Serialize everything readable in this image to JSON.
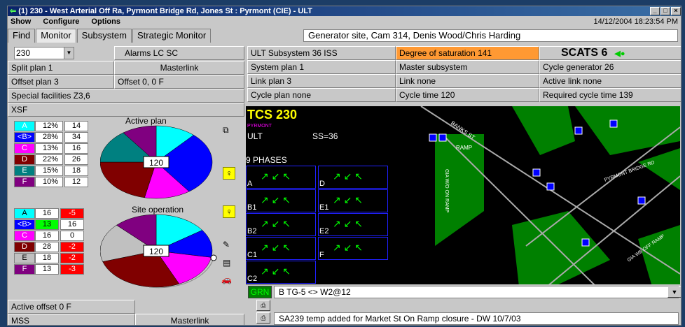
{
  "window": {
    "title": "(1)  230 - West Arterial Off Ra, Pyrmont Bridge Rd, Jones St : Pyrmont (CIE) - ULT"
  },
  "menu": [
    "Show",
    "Configure",
    "Options"
  ],
  "datetime": "14/12/2004  18:23:54 PM",
  "tabs": [
    "Find",
    "Monitor",
    "Subsystem",
    "Strategic Monitor"
  ],
  "site_description": "Generator site, Cam 314, Denis Wood/Chris Harding",
  "left": {
    "site_number": "230",
    "alarms": "Alarms LC SC",
    "split_plan": "Split plan 1",
    "masterlink": "Masterlink",
    "offset_plan": "Offset plan 3",
    "offset": "Offset 0, 0 F",
    "special": "Special facilities  Z3,6",
    "xsf": "XSF",
    "active_offset": "Active offset 0 F",
    "mss": "MSS",
    "masterlink_bottom": "Masterlink"
  },
  "active_plan": {
    "title": "Active plan",
    "cycle": "120",
    "rows": [
      {
        "phase": "A",
        "pct": "12%",
        "sec": "14",
        "color": "#00ffff"
      },
      {
        "phase": "<B>",
        "pct": "28%",
        "sec": "34",
        "color": "#0000ff"
      },
      {
        "phase": "C",
        "pct": "13%",
        "sec": "16",
        "color": "#ff00ff"
      },
      {
        "phase": "D",
        "pct": "22%",
        "sec": "26",
        "color": "#800000"
      },
      {
        "phase": "E",
        "pct": "15%",
        "sec": "18",
        "color": "#008080"
      },
      {
        "phase": "F",
        "pct": "10%",
        "sec": "12",
        "color": "#800080"
      }
    ]
  },
  "site_operation": {
    "title": "Site operation",
    "cycle": "120",
    "rows": [
      {
        "phase": "A",
        "actual": "16",
        "diff": "-5",
        "diffcolor": "#ff0000",
        "color": "#00ffff"
      },
      {
        "phase": "<B>",
        "actual": "13",
        "diff": "16",
        "diffcolor": "#ffffff",
        "color": "#0000ff",
        "actualcolor": "#00ff00"
      },
      {
        "phase": "C",
        "actual": "16",
        "diff": "0",
        "diffcolor": "#ffffff",
        "color": "#ff00ff"
      },
      {
        "phase": "D",
        "actual": "28",
        "diff": "-2",
        "diffcolor": "#ff0000",
        "color": "#800000"
      },
      {
        "phase": "E",
        "actual": "18",
        "diff": "-2",
        "diffcolor": "#ff0000",
        "color": "#c0c0c0"
      },
      {
        "phase": "F",
        "actual": "13",
        "diff": "-3",
        "diffcolor": "#ff0000",
        "color": "#800080"
      }
    ]
  },
  "info_grid": {
    "ult": "ULT Subsystem 36 ISS",
    "dos": "Degree of saturation 141",
    "scats": "SCATS 6",
    "system_plan": "System plan 1",
    "master_subsystem": "Master subsystem",
    "cycle_generator": "Cycle generator  26",
    "link_plan": "Link plan 3",
    "link_none": "Link none",
    "active_link": "Active link none",
    "cycle_plan": "Cycle plan none",
    "cycle_time": "Cycle time 120",
    "required_cycle": "Required cycle time 139"
  },
  "tcs": {
    "title": "TCS 230",
    "area": "PYRMONT",
    "ult": "ULT",
    "ss": "SS=36",
    "phases_label": "9 PHASES",
    "phase_labels": [
      "A",
      "D",
      "B1",
      "E1",
      "B2",
      "E2",
      "C1",
      "F",
      "C2"
    ]
  },
  "map_labels": {
    "banks": "BANKS ST",
    "ramp": "RAMP",
    "gwo": "GIA W/O ON RAMP",
    "pyrmont": "PYRMONT BRIDGE RD",
    "gia_wb": "GIA WB OFF RAMP"
  },
  "bottom": {
    "grn": "GRN",
    "phase_line": "B TG-5 <> W2@12",
    "note": "SA239 temp added for Market St On Ramp closure - DW 10/7/03"
  }
}
